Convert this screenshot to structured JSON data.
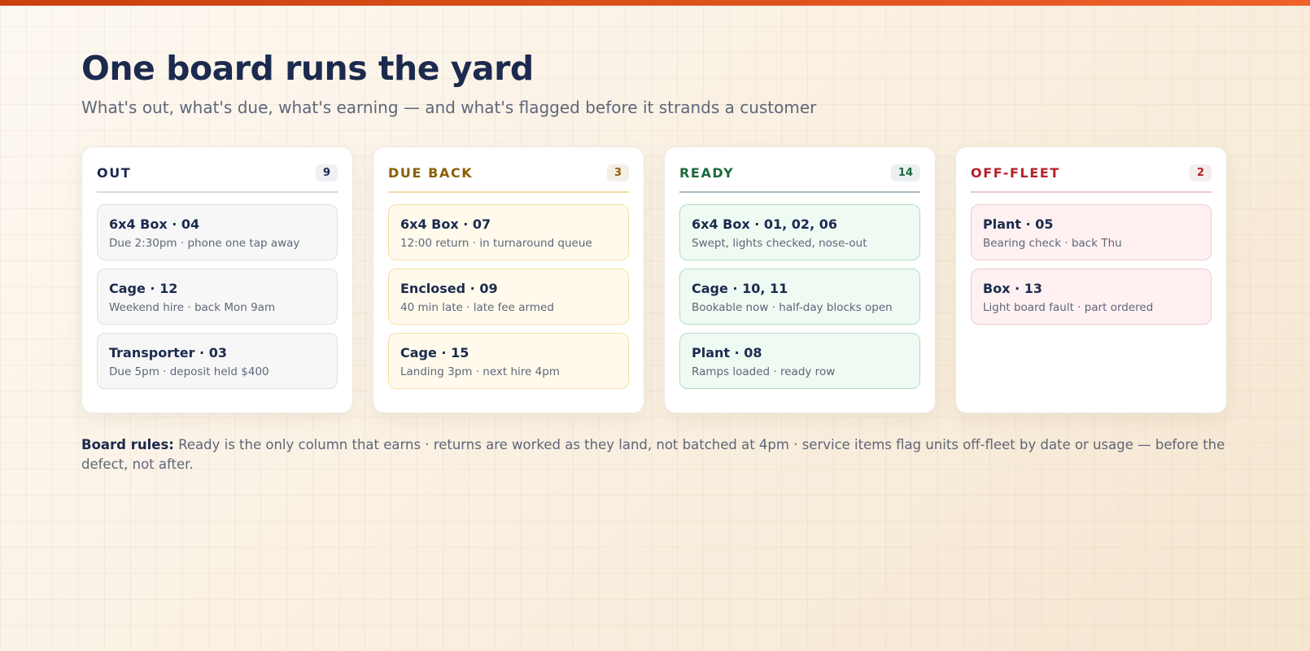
{
  "header": {
    "title": "One board runs the yard",
    "subtitle": "What's out, what's due, what's earning — and what's flagged before it strands a customer"
  },
  "columns": [
    {
      "title": "OUT",
      "count": "9",
      "cards": [
        {
          "title": "6x4 Box · 04",
          "sub": "Due 2:30pm · phone one tap away"
        },
        {
          "title": "Cage · 12",
          "sub": "Weekend hire · back Mon 9am"
        },
        {
          "title": "Transporter · 03",
          "sub": "Due 5pm · deposit held $400"
        }
      ]
    },
    {
      "title": "DUE BACK",
      "count": "3",
      "cards": [
        {
          "title": "6x4 Box · 07",
          "sub": "12:00 return · in turnaround queue"
        },
        {
          "title": "Enclosed · 09",
          "sub": "40 min late · late fee armed"
        },
        {
          "title": "Cage · 15",
          "sub": "Landing 3pm · next hire 4pm"
        }
      ]
    },
    {
      "title": "READY",
      "count": "14",
      "cards": [
        {
          "title": "6x4 Box · 01, 02, 06",
          "sub": "Swept, lights checked, nose-out"
        },
        {
          "title": "Cage · 10, 11",
          "sub": "Bookable now · half-day blocks open"
        },
        {
          "title": "Plant · 08",
          "sub": "Ramps loaded · ready row"
        }
      ]
    },
    {
      "title": "OFF-FLEET",
      "count": "2",
      "cards": [
        {
          "title": "Plant · 05",
          "sub": "Bearing check · back Thu"
        },
        {
          "title": "Box · 13",
          "sub": "Light board fault · part ordered"
        }
      ]
    }
  ],
  "rules": {
    "label": "Board rules:",
    "text": "Ready is the only column that earns · returns are worked as they land, not batched at 4pm · service items flag units off-fleet by date or usage — before the defect, not after."
  },
  "colors": {
    "accent_bar": "#e0531c",
    "out": "#1b2a4e",
    "due_back": "#8a5f00",
    "ready": "#1d6a3c",
    "off_fleet": "#b8202a"
  }
}
